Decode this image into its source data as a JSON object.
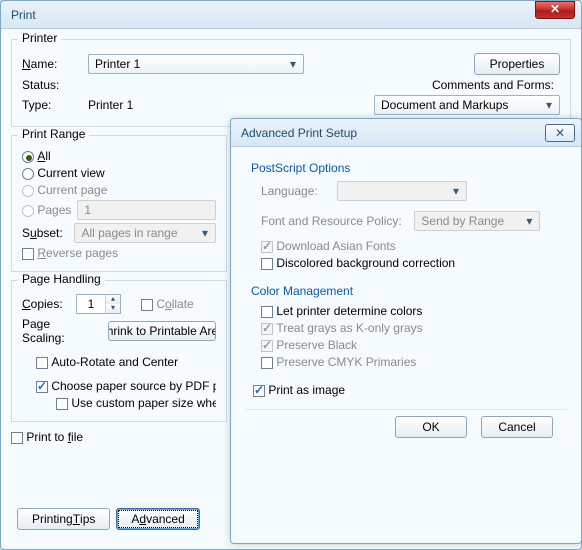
{
  "main": {
    "title": "Print",
    "printer": {
      "legend": "Printer",
      "name_label": "Name:",
      "name_value": "Printer 1",
      "status_label": "Status:",
      "status_value": "",
      "type_label": "Type:",
      "type_value": "Printer 1",
      "properties_btn": "Properties",
      "comments_label": "Comments and Forms:",
      "comments_value": "Document and Markups"
    },
    "range": {
      "legend": "Print Range",
      "all": "All",
      "current_view": "Current view",
      "current_page": "Current page",
      "pages": "Pages",
      "pages_value": "1",
      "subset_label": "Subset:",
      "subset_value": "All pages in range",
      "reverse": "Reverse pages"
    },
    "handling": {
      "legend": "Page Handling",
      "copies_label": "Copies:",
      "copies_value": "1",
      "collate": "Collate",
      "scaling_label": "Page Scaling:",
      "scaling_value": "Shrink to Printable Area",
      "auto_rotate": "Auto-Rotate and Center",
      "choose_paper": "Choose paper source by PDF page size",
      "custom_paper": "Use custom paper size when needed"
    },
    "print_to_file": "Print to file",
    "printing_tips_btn": "Printing Tips",
    "advanced_btn": "Advanced"
  },
  "adv": {
    "title": "Advanced Print Setup",
    "postscript": {
      "heading": "PostScript Options",
      "language_label": "Language:",
      "language_value": "",
      "policy_label": "Font and Resource Policy:",
      "policy_value": "Send by Range",
      "download_asian": "Download Asian Fonts",
      "discolored": "Discolored background correction"
    },
    "color": {
      "heading": "Color Management",
      "let_printer": "Let printer determine colors",
      "treat_grays": "Treat grays as K-only grays",
      "preserve_black": "Preserve Black",
      "preserve_cmyk": "Preserve CMYK Primaries"
    },
    "print_as_image": "Print as image",
    "ok_btn": "OK",
    "cancel_btn": "Cancel"
  }
}
